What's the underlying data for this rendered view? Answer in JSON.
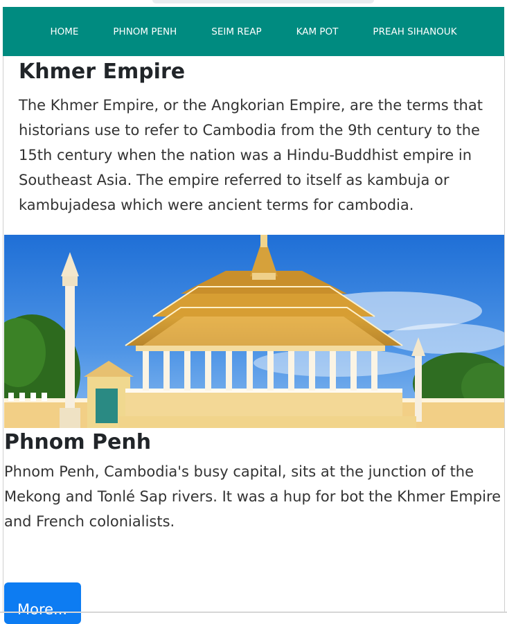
{
  "nav": {
    "items": [
      {
        "label": "HOME"
      },
      {
        "label": "PHNOM PENH"
      },
      {
        "label": "SEIM REAP"
      },
      {
        "label": "KAM POT"
      },
      {
        "label": "PREAH SIHANOUK"
      }
    ],
    "bg_color": "#008b80"
  },
  "intro": {
    "title": "Khmer Empire",
    "body": "The Khmer Empire, or the Angkorian Empire, are the terms that historians use to refer to Cambodia from the 9th century to the 15th century when the nation was a Hindu-Buddhist empire in Southeast Asia. The empire referred to itself as kambuja or kambujadesa which were ancient terms for cambodia."
  },
  "hero": {
    "icon": "temple-photo"
  },
  "section": {
    "title": "Phnom Penh",
    "body": "Phnom Penh, Cambodia's busy capital, sits at the junction of the Mekong and Tonlé Sap rivers. It was a hup for bot the Khmer Empire and French colonialists.",
    "button_label": "More..."
  },
  "colors": {
    "button": "#0d7cf2"
  }
}
